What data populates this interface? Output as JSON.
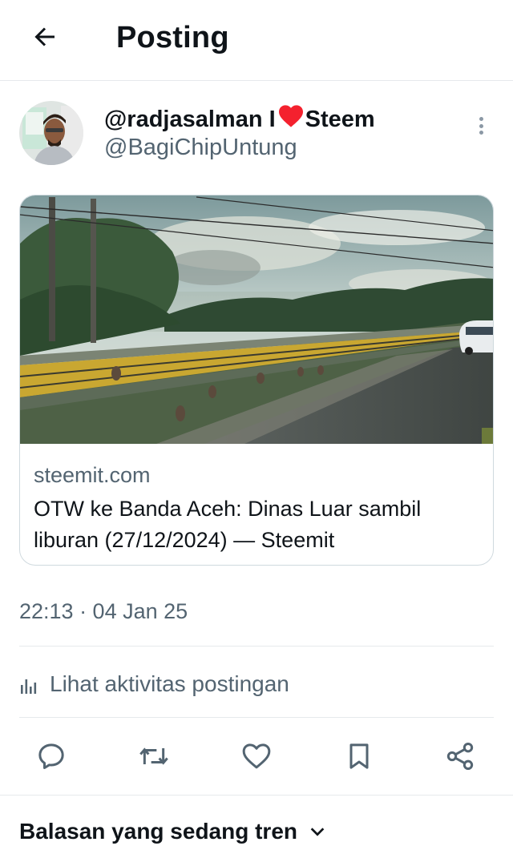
{
  "header": {
    "title": "Posting",
    "back_icon": "arrow-left-icon"
  },
  "author": {
    "display_name_prefix": "@radjasalman I",
    "display_name_suffix": "Steem",
    "heart_icon": "heart-icon",
    "heart_color": "#f4212e",
    "handle": "@BagiChipUntung",
    "more_icon": "more-vertical-icon"
  },
  "link_card": {
    "domain": "steemit.com",
    "title": "OTW ke Banda Aceh: Dinas Luar sambil liburan (27/12/2024) — Steemit"
  },
  "post_meta": {
    "timestamp": "22:13 · 04 Jan 25"
  },
  "activity": {
    "label": "Lihat aktivitas postingan",
    "icon": "bar-chart-icon"
  },
  "actions": [
    {
      "name": "reply",
      "icon": "comment-icon"
    },
    {
      "name": "repost",
      "icon": "repost-icon"
    },
    {
      "name": "like",
      "icon": "heart-outline-icon"
    },
    {
      "name": "bookmark",
      "icon": "bookmark-icon"
    },
    {
      "name": "share",
      "icon": "share-icon"
    }
  ],
  "replies": {
    "label": "Balasan yang sedang tren",
    "icon": "chevron-down-icon"
  },
  "colors": {
    "text": "#0f1419",
    "secondary": "#536471",
    "border": "#cfd9de",
    "divider": "#e6e9ec"
  }
}
